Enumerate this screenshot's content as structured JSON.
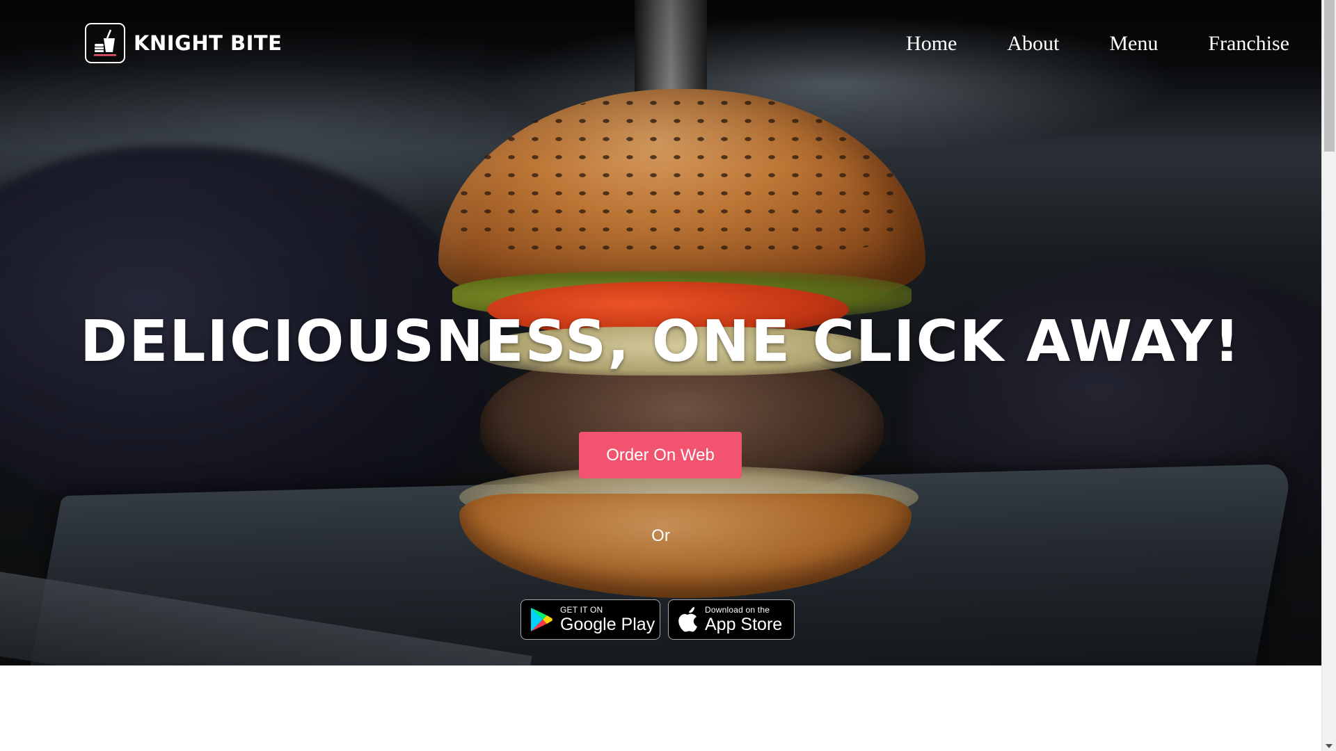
{
  "brand": {
    "name": "KNIGHT BITE"
  },
  "nav": {
    "items": [
      "Home",
      "About",
      "Menu",
      "Franchise"
    ]
  },
  "hero": {
    "headline": "DELICIOUSNESS, ONE CLICK AWAY!",
    "order_button": "Order On Web",
    "or_text": "Or"
  },
  "stores": {
    "google": {
      "small": "GET IT ON",
      "big": "Google Play"
    },
    "apple": {
      "small": "Download on the",
      "big": "App Store"
    }
  },
  "colors": {
    "accent": "#f2546f",
    "text_on_hero": "#ffffff",
    "badge_bg": "#000000"
  }
}
